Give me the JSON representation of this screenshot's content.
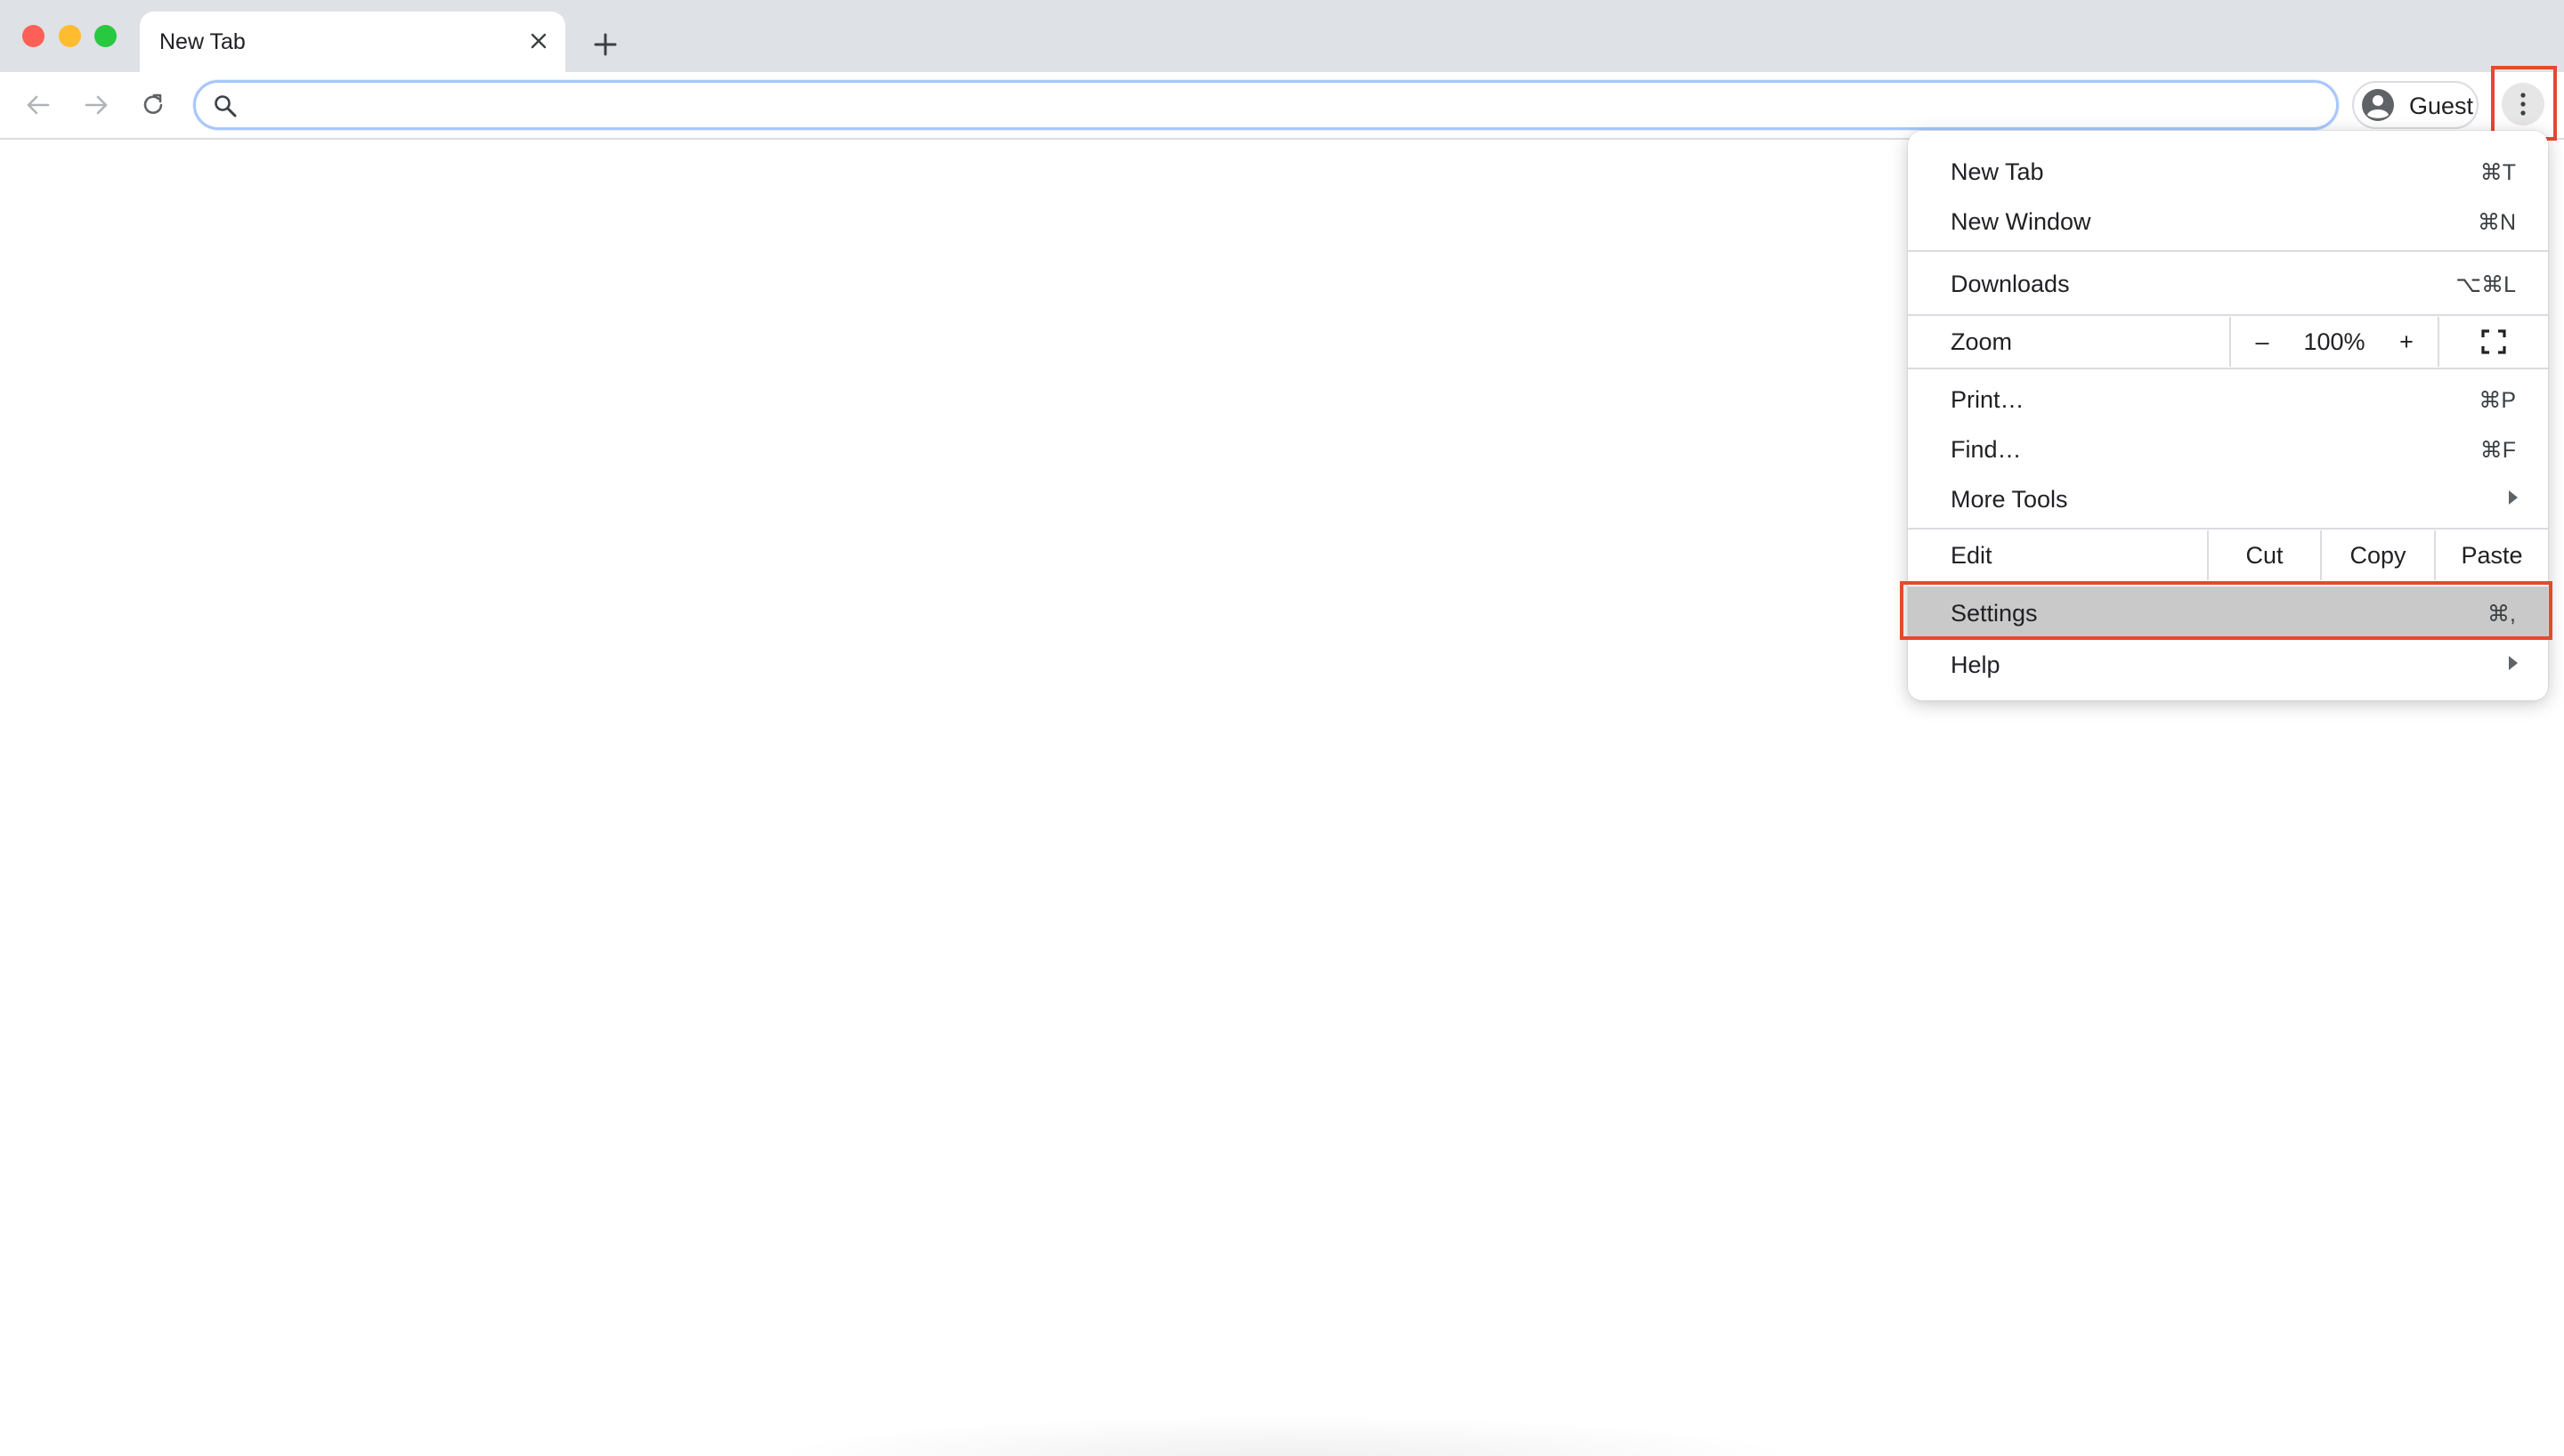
{
  "window": {
    "traffic_lights": {
      "close": "#fe5f57",
      "minimize": "#febc2e",
      "zoom": "#28c840"
    }
  },
  "tabs": [
    {
      "title": "New Tab",
      "active": true
    }
  ],
  "toolbar": {
    "omnibox_value": "",
    "profile_label": "Guest",
    "accent": "#a8c7fa"
  },
  "menu": {
    "items_top": [
      {
        "label": "New Tab",
        "shortcut": "⌘T"
      },
      {
        "label": "New Window",
        "shortcut": "⌘N"
      }
    ],
    "downloads": {
      "label": "Downloads",
      "shortcut": "⌥⌘L"
    },
    "zoom": {
      "label": "Zoom",
      "minus": "–",
      "value": "100%",
      "plus": "+"
    },
    "items_mid": [
      {
        "label": "Print…",
        "shortcut": "⌘P"
      },
      {
        "label": "Find…",
        "shortcut": "⌘F"
      },
      {
        "label": "More Tools",
        "submenu": true
      }
    ],
    "edit": {
      "label": "Edit",
      "cut": "Cut",
      "copy": "Copy",
      "paste": "Paste"
    },
    "settings": {
      "label": "Settings",
      "shortcut": "⌘,",
      "highlighted": true
    },
    "help": {
      "label": "Help",
      "submenu": true
    }
  },
  "highlight_color": "#e34a2f"
}
